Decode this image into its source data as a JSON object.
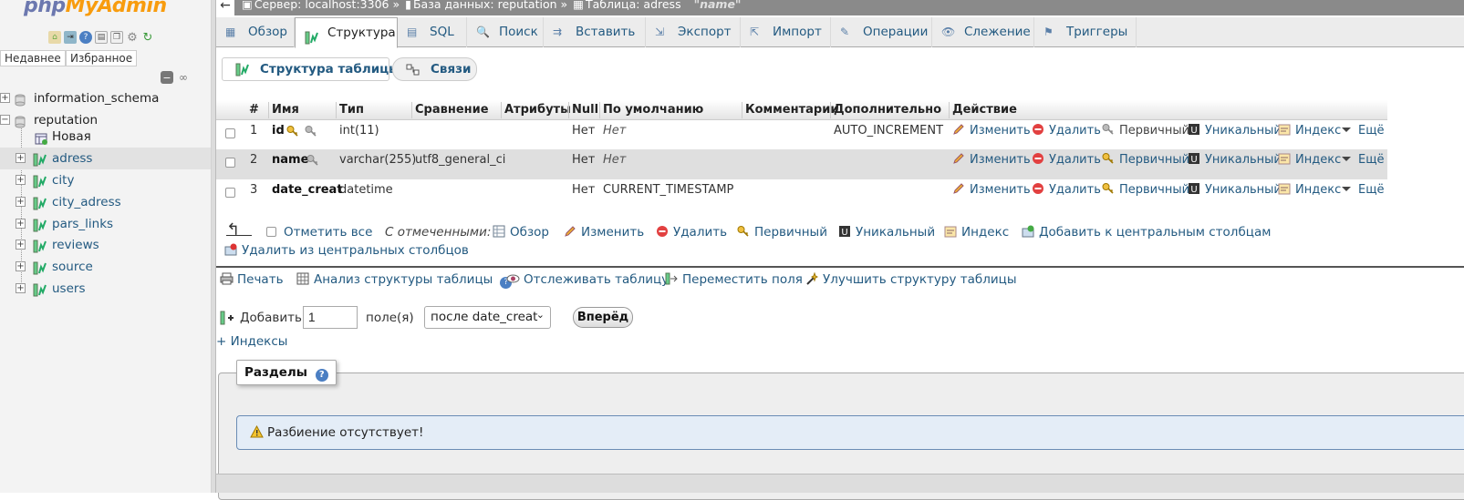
{
  "nav": {
    "logo_php": "php",
    "logo_my": "MyAdmin",
    "recent_btn": "Недавнее",
    "favorites_btn": "Избранное",
    "databases": [
      {
        "name": "information_schema",
        "expanded": false
      },
      {
        "name": "reputation",
        "expanded": true
      }
    ],
    "tables": [
      {
        "name": "Новая"
      },
      {
        "name": "adress"
      },
      {
        "name": "city"
      },
      {
        "name": "city_adress"
      },
      {
        "name": "pars_links"
      },
      {
        "name": "reviews"
      },
      {
        "name": "source"
      },
      {
        "name": "users"
      }
    ]
  },
  "breadcrumb": {
    "server": "Сервер: localhost:3306 »",
    "database": "База данных: reputation »",
    "table": "Таблица: adress",
    "comment": "\"name\""
  },
  "tabs": [
    "Обзор",
    "Структура",
    "SQL",
    "Поиск",
    "Вставить",
    "Экспорт",
    "Импорт",
    "Операции",
    "Слежение",
    "Триггеры"
  ],
  "active_tab": "Структура",
  "subtabs": [
    "Структура таблицы",
    "Связи"
  ],
  "table": {
    "columns": [
      "#",
      "Имя",
      "Тип",
      "Сравнение",
      "Атрибуты",
      "Null",
      "По умолчанию",
      "Комментарии",
      "Дополнительно",
      "Действие"
    ],
    "rows": [
      {
        "num": "1",
        "name": "id",
        "type": "int(11)",
        "collation": "",
        "attributes": "",
        "null": "Нет",
        "default": "Нет",
        "default_italic": true,
        "comments": "",
        "extra": "AUTO_INCREMENT"
      },
      {
        "num": "2",
        "name": "name",
        "type": "varchar(255)",
        "collation": "utf8_general_ci",
        "attributes": "",
        "null": "Нет",
        "default": "Нет",
        "default_italic": true,
        "comments": "",
        "extra": ""
      },
      {
        "num": "3",
        "name": "date_creat",
        "type": "datetime",
        "collation": "",
        "attributes": "",
        "null": "Нет",
        "default": "CURRENT_TIMESTAMP",
        "default_italic": false,
        "comments": "",
        "extra": ""
      }
    ],
    "actions": [
      "Изменить",
      "Удалить",
      "Первичный",
      "Уникальный",
      "Индекс",
      "Ещё"
    ]
  },
  "bulk": {
    "check_all": "Отметить все",
    "with_selected": "С отмеченными:",
    "ops": [
      "Обзор",
      "Изменить",
      "Удалить",
      "Первичный",
      "Уникальный",
      "Индекс",
      "Добавить к центральным столбцам"
    ],
    "remove_central": "Удалить из центральных столбцов"
  },
  "tools": [
    "Печать",
    "Анализ структуры таблицы",
    "Отслеживать таблицу",
    "Переместить поля",
    "Улучшить структуру таблицы"
  ],
  "add_form": {
    "add_label": "Добавить",
    "count_value": "1",
    "fields_label": "поле(я)",
    "position_value": "после date_creat",
    "go_label": "Вперёд"
  },
  "indexes_link": "+ Индексы",
  "partitions": {
    "legend": "Разделы",
    "notice": "Разбиение отсутствует!"
  },
  "colors": {
    "link": "#235a81",
    "logo_php": "#6c78af",
    "logo_accent": "#f89c0e"
  }
}
